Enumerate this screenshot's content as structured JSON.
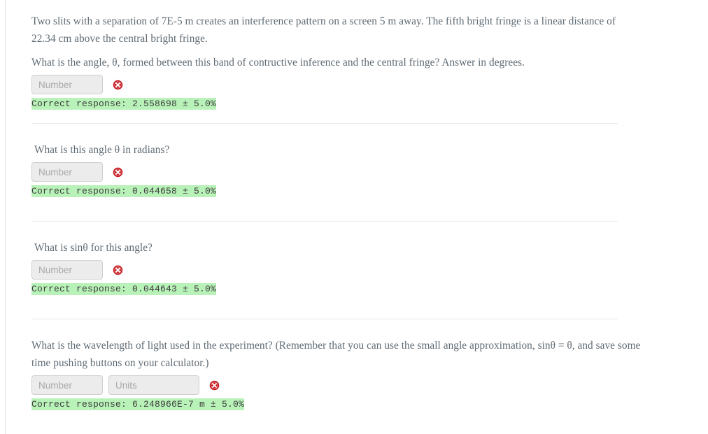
{
  "page": {
    "title": "Physics homework question — double slit interference",
    "text_color": "#5f6b74",
    "correct_bg": "#b9f2b9",
    "error_color": "#c5161c"
  },
  "intro": {
    "line1": "Two slits with a separation of 7E-5 m creates an interference pattern on a screen 5 m away. The fifth bright fringe is a linear distance of",
    "line2": "22.34 cm above the central bright fringe."
  },
  "inputs": {
    "number_placeholder": "Number",
    "units_placeholder": "Units",
    "number_value": "",
    "units_value": ""
  },
  "icons": {
    "incorrect": "incorrect-answer-icon"
  },
  "questions": [
    {
      "id": "q1",
      "prompt": "What is the angle, θ, formed between this band of contructive inference and the central fringe? Answer in degrees.",
      "prompt2": "",
      "has_units": false,
      "correct_response": "Correct response: 2.558698 ± 5.0%"
    },
    {
      "id": "q2",
      "prompt": "What is this angle θ in radians?",
      "prompt2": "",
      "has_units": false,
      "correct_response": "Correct response: 0.044658 ± 5.0%"
    },
    {
      "id": "q3",
      "prompt": "What is sinθ for this angle?",
      "prompt2": "",
      "has_units": false,
      "correct_response": "Correct response: 0.044643 ± 5.0%"
    },
    {
      "id": "q4",
      "prompt": "What is the wavelength of light used in the experiment? (Remember that you can use the small angle approximation, sinθ = θ, and save",
      "prompt2": "some time pushing buttons on your calculator.)",
      "has_units": true,
      "correct_response": "Correct response: 6.248966E-7 m ± 5.0%"
    }
  ]
}
